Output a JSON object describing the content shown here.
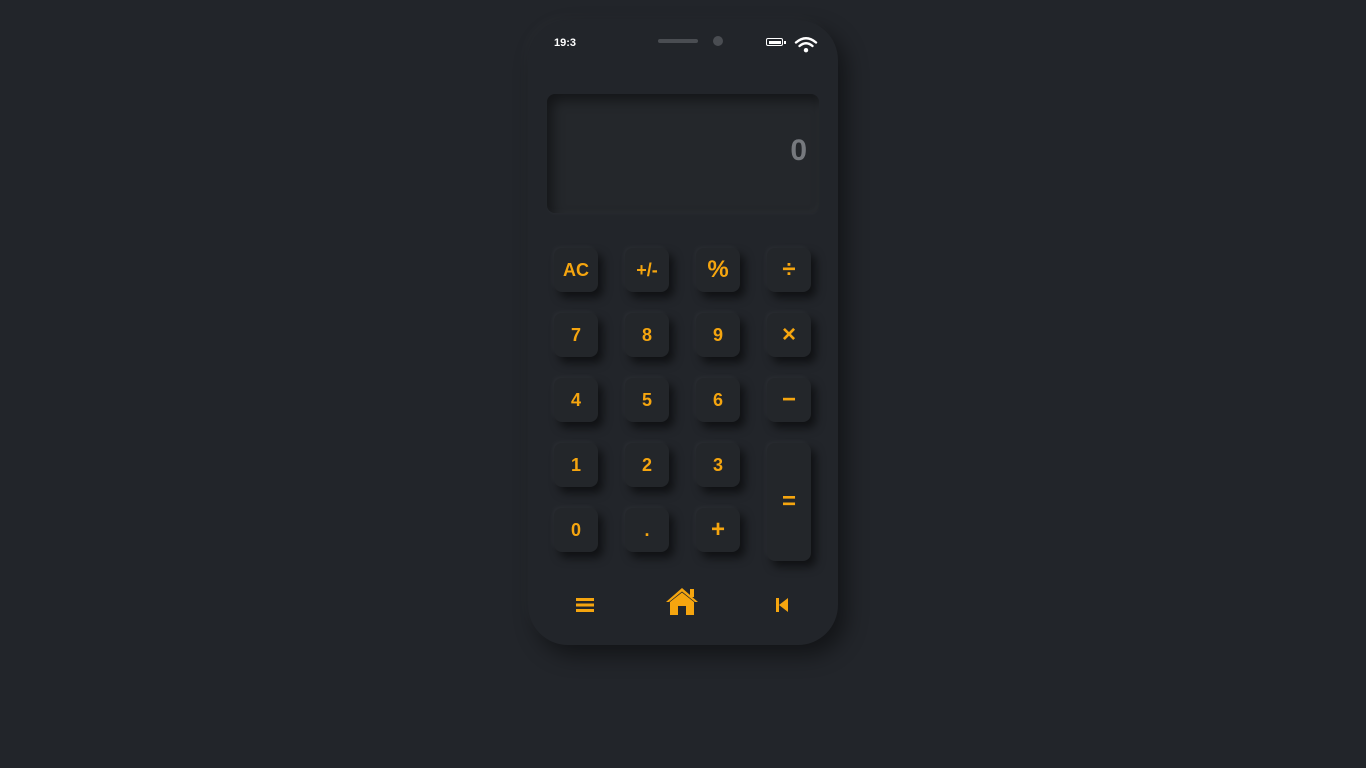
{
  "status_bar": {
    "time": "19:3",
    "icons": [
      "battery-icon",
      "wifi-icon"
    ]
  },
  "display": {
    "value": "0"
  },
  "keypad": {
    "keys": [
      {
        "name": "clear-button",
        "label": "AC"
      },
      {
        "name": "sign-toggle-button",
        "label": "+/-"
      },
      {
        "name": "percent-button",
        "label": "%"
      },
      {
        "name": "divide-button",
        "label": "÷"
      },
      {
        "name": "digit-7-button",
        "label": "7"
      },
      {
        "name": "digit-8-button",
        "label": "8"
      },
      {
        "name": "digit-9-button",
        "label": "9"
      },
      {
        "name": "multiply-button",
        "label": "×"
      },
      {
        "name": "digit-4-button",
        "label": "4"
      },
      {
        "name": "digit-5-button",
        "label": "5"
      },
      {
        "name": "digit-6-button",
        "label": "6"
      },
      {
        "name": "subtract-button",
        "label": "−"
      },
      {
        "name": "digit-1-button",
        "label": "1"
      },
      {
        "name": "digit-2-button",
        "label": "2"
      },
      {
        "name": "digit-3-button",
        "label": "3"
      },
      {
        "name": "equals-button",
        "label": "="
      },
      {
        "name": "digit-0-button",
        "label": "0"
      },
      {
        "name": "decimal-button",
        "label": "."
      },
      {
        "name": "add-button",
        "label": "+"
      }
    ]
  },
  "nav_bar": {
    "icons": [
      "menu-icon",
      "home-icon",
      "skip-back-icon"
    ]
  },
  "colors": {
    "background": "#22252a",
    "accent": "#f5a50f",
    "display_text": "#76797e",
    "status_text": "#ffffff"
  }
}
